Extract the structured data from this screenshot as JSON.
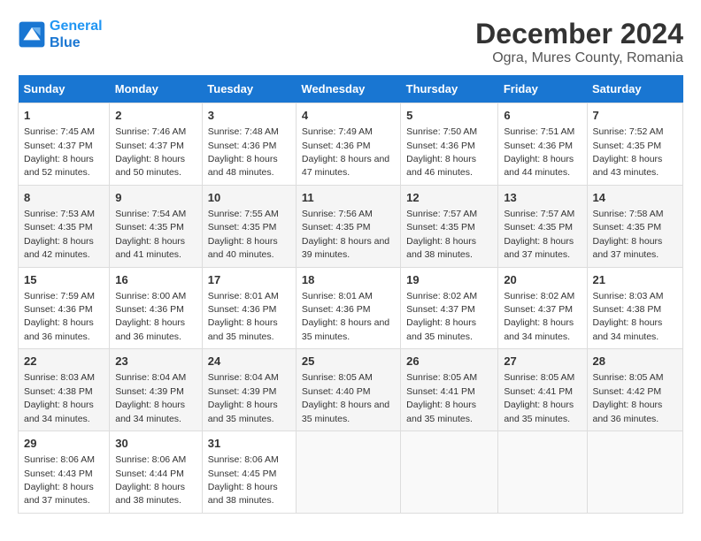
{
  "logo": {
    "line1": "General",
    "line2": "Blue"
  },
  "title": "December 2024",
  "subtitle": "Ogra, Mures County, Romania",
  "days_header": [
    "Sunday",
    "Monday",
    "Tuesday",
    "Wednesday",
    "Thursday",
    "Friday",
    "Saturday"
  ],
  "weeks": [
    [
      {
        "day": "1",
        "sunrise": "7:45 AM",
        "sunset": "4:37 PM",
        "daylight": "8 hours and 52 minutes."
      },
      {
        "day": "2",
        "sunrise": "7:46 AM",
        "sunset": "4:37 PM",
        "daylight": "8 hours and 50 minutes."
      },
      {
        "day": "3",
        "sunrise": "7:48 AM",
        "sunset": "4:36 PM",
        "daylight": "8 hours and 48 minutes."
      },
      {
        "day": "4",
        "sunrise": "7:49 AM",
        "sunset": "4:36 PM",
        "daylight": "8 hours and 47 minutes."
      },
      {
        "day": "5",
        "sunrise": "7:50 AM",
        "sunset": "4:36 PM",
        "daylight": "8 hours and 46 minutes."
      },
      {
        "day": "6",
        "sunrise": "7:51 AM",
        "sunset": "4:36 PM",
        "daylight": "8 hours and 44 minutes."
      },
      {
        "day": "7",
        "sunrise": "7:52 AM",
        "sunset": "4:35 PM",
        "daylight": "8 hours and 43 minutes."
      }
    ],
    [
      {
        "day": "8",
        "sunrise": "7:53 AM",
        "sunset": "4:35 PM",
        "daylight": "8 hours and 42 minutes."
      },
      {
        "day": "9",
        "sunrise": "7:54 AM",
        "sunset": "4:35 PM",
        "daylight": "8 hours and 41 minutes."
      },
      {
        "day": "10",
        "sunrise": "7:55 AM",
        "sunset": "4:35 PM",
        "daylight": "8 hours and 40 minutes."
      },
      {
        "day": "11",
        "sunrise": "7:56 AM",
        "sunset": "4:35 PM",
        "daylight": "8 hours and 39 minutes."
      },
      {
        "day": "12",
        "sunrise": "7:57 AM",
        "sunset": "4:35 PM",
        "daylight": "8 hours and 38 minutes."
      },
      {
        "day": "13",
        "sunrise": "7:57 AM",
        "sunset": "4:35 PM",
        "daylight": "8 hours and 37 minutes."
      },
      {
        "day": "14",
        "sunrise": "7:58 AM",
        "sunset": "4:35 PM",
        "daylight": "8 hours and 37 minutes."
      }
    ],
    [
      {
        "day": "15",
        "sunrise": "7:59 AM",
        "sunset": "4:36 PM",
        "daylight": "8 hours and 36 minutes."
      },
      {
        "day": "16",
        "sunrise": "8:00 AM",
        "sunset": "4:36 PM",
        "daylight": "8 hours and 36 minutes."
      },
      {
        "day": "17",
        "sunrise": "8:01 AM",
        "sunset": "4:36 PM",
        "daylight": "8 hours and 35 minutes."
      },
      {
        "day": "18",
        "sunrise": "8:01 AM",
        "sunset": "4:36 PM",
        "daylight": "8 hours and 35 minutes."
      },
      {
        "day": "19",
        "sunrise": "8:02 AM",
        "sunset": "4:37 PM",
        "daylight": "8 hours and 35 minutes."
      },
      {
        "day": "20",
        "sunrise": "8:02 AM",
        "sunset": "4:37 PM",
        "daylight": "8 hours and 34 minutes."
      },
      {
        "day": "21",
        "sunrise": "8:03 AM",
        "sunset": "4:38 PM",
        "daylight": "8 hours and 34 minutes."
      }
    ],
    [
      {
        "day": "22",
        "sunrise": "8:03 AM",
        "sunset": "4:38 PM",
        "daylight": "8 hours and 34 minutes."
      },
      {
        "day": "23",
        "sunrise": "8:04 AM",
        "sunset": "4:39 PM",
        "daylight": "8 hours and 34 minutes."
      },
      {
        "day": "24",
        "sunrise": "8:04 AM",
        "sunset": "4:39 PM",
        "daylight": "8 hours and 35 minutes."
      },
      {
        "day": "25",
        "sunrise": "8:05 AM",
        "sunset": "4:40 PM",
        "daylight": "8 hours and 35 minutes."
      },
      {
        "day": "26",
        "sunrise": "8:05 AM",
        "sunset": "4:41 PM",
        "daylight": "8 hours and 35 minutes."
      },
      {
        "day": "27",
        "sunrise": "8:05 AM",
        "sunset": "4:41 PM",
        "daylight": "8 hours and 35 minutes."
      },
      {
        "day": "28",
        "sunrise": "8:05 AM",
        "sunset": "4:42 PM",
        "daylight": "8 hours and 36 minutes."
      }
    ],
    [
      {
        "day": "29",
        "sunrise": "8:06 AM",
        "sunset": "4:43 PM",
        "daylight": "8 hours and 37 minutes."
      },
      {
        "day": "30",
        "sunrise": "8:06 AM",
        "sunset": "4:44 PM",
        "daylight": "8 hours and 38 minutes."
      },
      {
        "day": "31",
        "sunrise": "8:06 AM",
        "sunset": "4:45 PM",
        "daylight": "8 hours and 38 minutes."
      },
      null,
      null,
      null,
      null
    ]
  ]
}
